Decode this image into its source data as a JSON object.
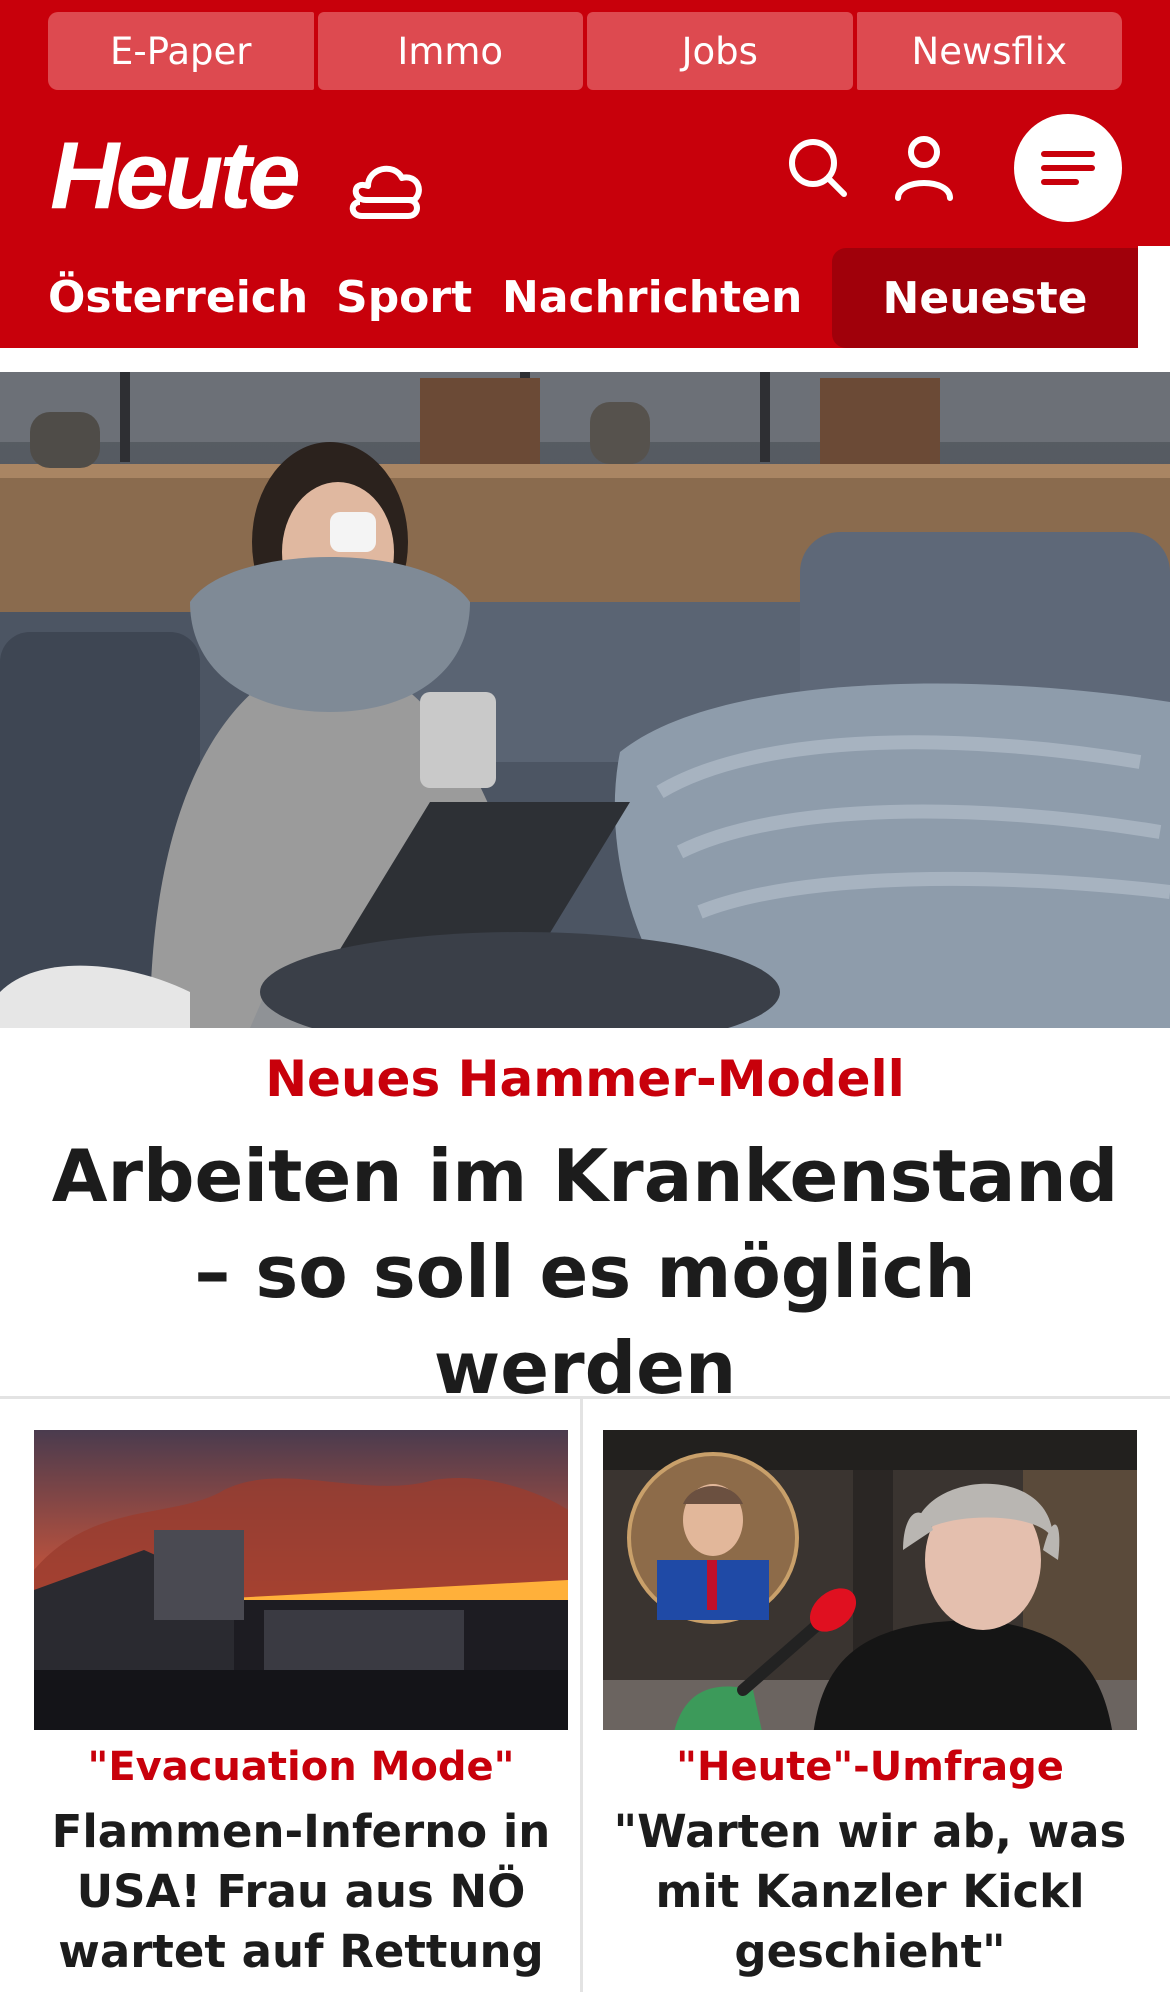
{
  "top_links": [
    "E-Paper",
    "Immo",
    "Jobs",
    "Newsflix"
  ],
  "brand": {
    "logo_text": "Heute",
    "weather_icon": "cloud-sun-icon"
  },
  "header_icons": {
    "search": "search-icon",
    "account": "user-icon",
    "menu": "menu-icon"
  },
  "nav": {
    "items": [
      "Österreich",
      "Sport",
      "Nachrichten"
    ],
    "active": "Neueste"
  },
  "hero": {
    "kicker": "Neues Hammer-Modell",
    "title": "Arbeiten im Krankenstand – so soll es möglich werden"
  },
  "cards": [
    {
      "kicker": "\"Evacuation Mode\"",
      "title": "Flammen-Inferno in USA! Frau aus NÖ wartet auf Rettung"
    },
    {
      "kicker": "\"Heute\"-Umfrage",
      "title": "\"Warten wir ab, was mit Kanzler Kickl geschieht\""
    }
  ],
  "colors": {
    "brand_red": "#c8000b",
    "nav_active": "#a0000a",
    "top_link_bg": "#dd4a50"
  }
}
